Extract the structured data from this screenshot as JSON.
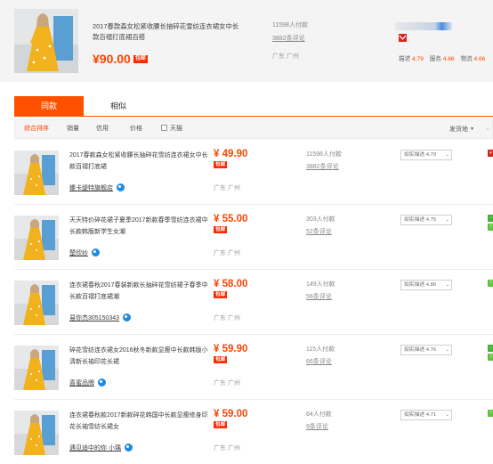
{
  "top": {
    "title": "2017春款森女松紧收腰长抽碎花雪纺连衣裙女中长款百褶打底裙百搭",
    "price": "¥90.00",
    "tag": "包邮",
    "sales": "11598人付款",
    "comments": "3882条评论",
    "location": "广东 广州",
    "scores": [
      {
        "label": "描述",
        "value": "4.79"
      },
      {
        "label": "服务",
        "value": "4.66"
      },
      {
        "label": "物流",
        "value": "4.66"
      }
    ]
  },
  "tabs": [
    {
      "label": "同款",
      "active": true
    },
    {
      "label": "相似",
      "active": false
    }
  ],
  "sort": {
    "items": [
      "综合排序",
      "销量",
      "信用",
      "价格"
    ],
    "tmall": "天猫",
    "ship_from": "发货地",
    "accent": "#ff5000"
  },
  "rows": [
    {
      "title": "2017春款森女松紧收腰长抽碎花雪纺连衣裙女中长款百褶打底裙",
      "shop": "螺卡缇特旗舰店",
      "price": "¥ 49.90",
      "tag": "包邮",
      "location": "广东 广州",
      "sales": "11598人付款",
      "comments": "3882条评论",
      "desc": "如实描述 4.79",
      "badges": [
        {
          "icon": "medal-red",
          "text": "天"
        }
      ]
    },
    {
      "title": "天天特价碎花裙子夏季2017新款春季雪纺连衣裙中长款韩版新学生女潮",
      "shop": "楚欣纱",
      "price": "¥ 55.00",
      "tag": "包邮",
      "location": "广东 广州",
      "sales": "303人付款",
      "comments": "52条评论",
      "desc": "如实描述 4.75",
      "badges": [
        {
          "icon": "clock-green",
          "text": "3"
        },
        {
          "icon": "seven-days",
          "text": "7"
        }
      ]
    },
    {
      "title": "连衣裙春秋2017春装新款长抽碎花雪纺裙子春季中长款百褶打底裙潮",
      "shop": "易你杰305150343",
      "price": "¥ 58.00",
      "tag": "包邮",
      "location": "广东 广州",
      "sales": "149人付款",
      "comments": "56条评论",
      "desc": "如实描述 4.86",
      "badges": [
        {
          "icon": "seven-days",
          "text": "7"
        }
      ]
    },
    {
      "title": "碎花雪纺连衣裙女2016秋冬新款显瘦中长款韩版小清新长袖印花长裙",
      "shop": "喜蜜品牌",
      "price": "¥ 59.90",
      "tag": "包邮",
      "location": "广东 广州",
      "sales": "115人付款",
      "comments": "66条评论",
      "desc": "如实描述 4.76",
      "badges": [
        {
          "icon": "clock-green",
          "text": "3"
        },
        {
          "icon": "seven-days",
          "text": "7"
        }
      ]
    },
    {
      "title": "连衣裙春秋款2017新款碎花韩国中长款显瘦修身印花长袖雪纺长裙女",
      "shop": "遇见迪中的你 小瑀",
      "price": "¥ 59.00",
      "tag": "包邮",
      "location": "广东 广州",
      "sales": "64人付款",
      "comments": "9条评论",
      "desc": "如实描述 4.71",
      "badges": [
        {
          "icon": "seven-days",
          "text": "7"
        }
      ]
    }
  ]
}
